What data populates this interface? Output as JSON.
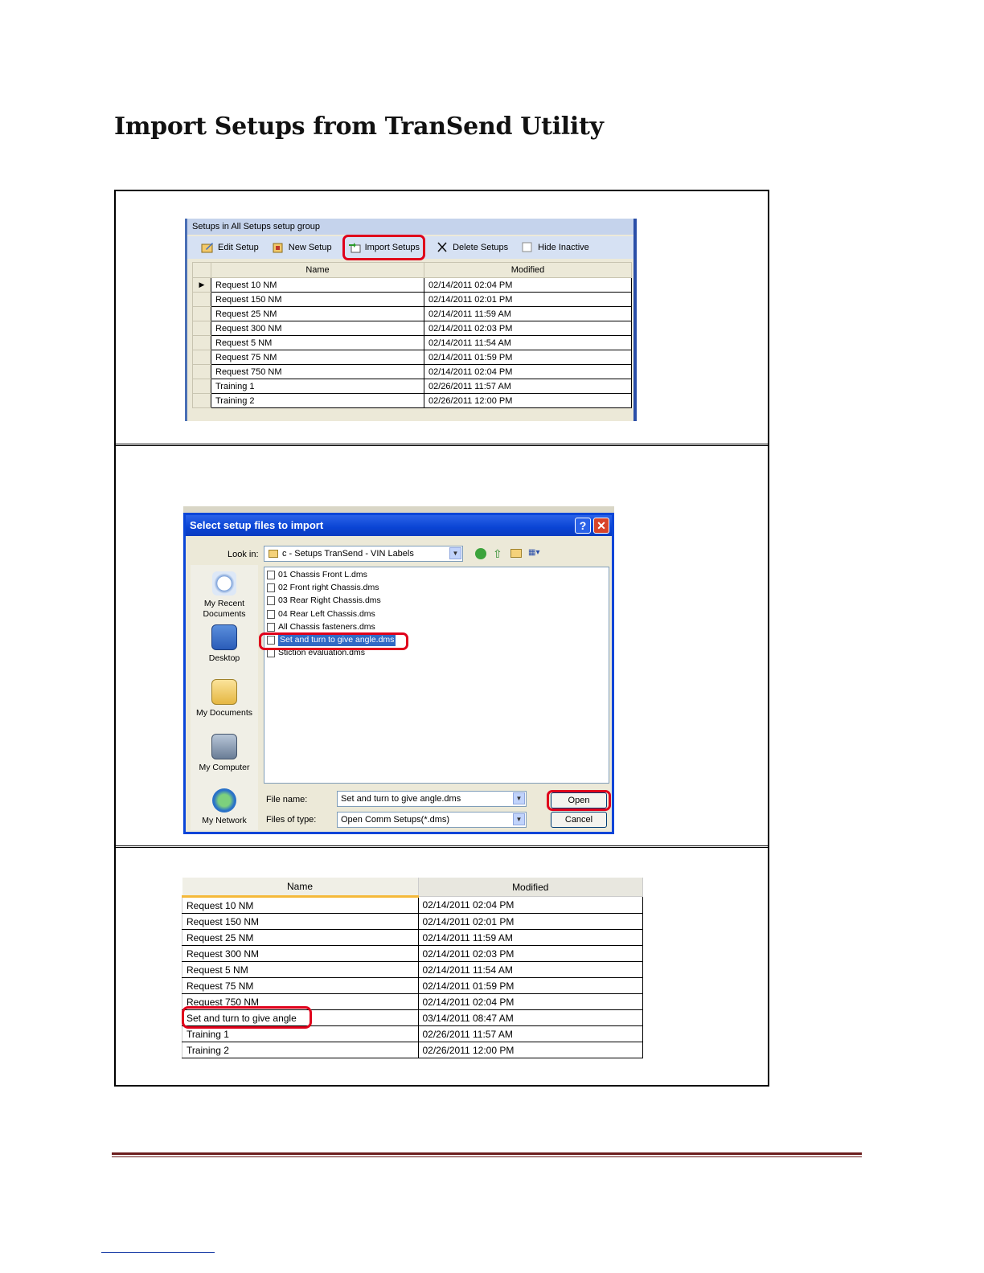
{
  "page_title": "Import Setups from TranSend Utility",
  "panel1": {
    "caption": "Setups in All Setups setup group",
    "toolbar": {
      "edit_setup": "Edit Setup",
      "new_setup": "New Setup",
      "import_setups": "Import Setups",
      "delete_setups": "Delete Setups",
      "hide_inactive": "Hide Inactive"
    },
    "columns": [
      "Name",
      "Modified"
    ],
    "rows": [
      {
        "name": "Request 10 NM",
        "modified": "02/14/2011 02:04 PM"
      },
      {
        "name": "Request 150 NM",
        "modified": "02/14/2011 02:01 PM"
      },
      {
        "name": "Request 25 NM",
        "modified": "02/14/2011 11:59 AM"
      },
      {
        "name": "Request 300 NM",
        "modified": "02/14/2011 02:03 PM"
      },
      {
        "name": "Request 5 NM",
        "modified": "02/14/2011 11:54 AM"
      },
      {
        "name": "Request 75 NM",
        "modified": "02/14/2011 01:59 PM"
      },
      {
        "name": "Request 750 NM",
        "modified": "02/14/2011 02:04 PM"
      },
      {
        "name": "Training 1",
        "modified": "02/26/2011 11:57 AM"
      },
      {
        "name": "Training 2",
        "modified": "02/26/2011 12:00 PM"
      }
    ]
  },
  "dialog": {
    "title": "Select setup files to import",
    "help_btn": "?",
    "close_btn": "✕",
    "look_in_label": "Look in:",
    "look_in_value": "c - Setups TranSend - VIN Labels",
    "places": [
      "My Recent Documents",
      "Desktop",
      "My Documents",
      "My Computer",
      "My Network"
    ],
    "files": [
      "01 Chassis Front L.dms",
      "02 Front right Chassis.dms",
      "03 Rear Right Chassis.dms",
      "04 Rear Left Chassis.dms",
      "All Chassis fasteners.dms",
      "Set and turn to give angle.dms",
      "Stiction evaluation.dms"
    ],
    "file_name_label": "File name:",
    "file_name_value": "Set and turn to give angle.dms",
    "file_type_label": "Files of type:",
    "file_type_value": "Open Comm Setups(*.dms)",
    "open_btn": "Open",
    "cancel_btn": "Cancel"
  },
  "panel3": {
    "columns": [
      "Name",
      "Modified"
    ],
    "rows": [
      {
        "name": "Request 10 NM",
        "modified": "02/14/2011 02:04 PM"
      },
      {
        "name": "Request 150 NM",
        "modified": "02/14/2011 02:01 PM"
      },
      {
        "name": "Request 25 NM",
        "modified": "02/14/2011 11:59 AM"
      },
      {
        "name": "Request 300 NM",
        "modified": "02/14/2011 02:03 PM"
      },
      {
        "name": "Request 5 NM",
        "modified": "02/14/2011 11:54 AM"
      },
      {
        "name": "Request 75 NM",
        "modified": "02/14/2011 01:59 PM"
      },
      {
        "name": "Request 750 NM",
        "modified": "02/14/2011 02:04 PM"
      },
      {
        "name": "Set and turn to give angle",
        "modified": "03/14/2011 08:47 AM"
      },
      {
        "name": "Training 1",
        "modified": "02/26/2011 11:57 AM"
      },
      {
        "name": "Training 2",
        "modified": "02/26/2011 12:00 PM"
      }
    ]
  }
}
